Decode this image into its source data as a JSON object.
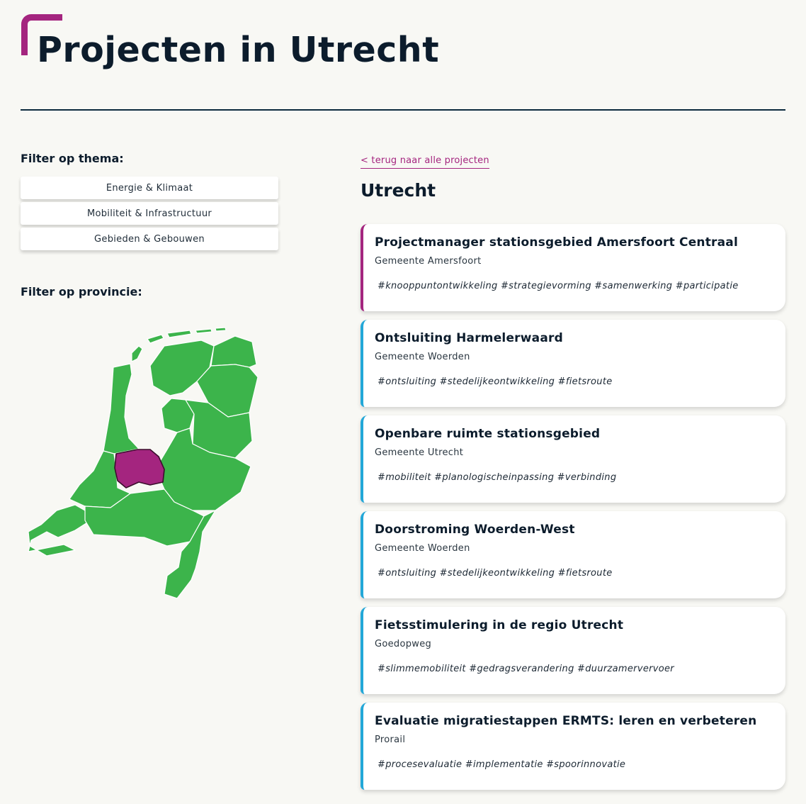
{
  "page": {
    "title": "Projecten in Utrecht"
  },
  "colors": {
    "accent": "#a4257f",
    "map_fill": "#3cb44b",
    "selected_province": "#a4257f",
    "card_border": "#22a7d8"
  },
  "filters": {
    "theme_heading": "Filter op thema:",
    "themes": [
      "Energie & Klimaat",
      "Mobiliteit & Infrastructuur",
      "Gebieden & Gebouwen"
    ],
    "province_heading": "Filter op provincie:",
    "selected_province": "Utrecht"
  },
  "results": {
    "back_link": "< terug naar alle projecten",
    "heading": "Utrecht",
    "projects": [
      {
        "title": "Projectmanager stationsgebied Amersfoort Centraal",
        "org": "Gemeente Amersfoort",
        "tags": "#knooppuntontwikkeling #strategievorming #samenwerking #participatie"
      },
      {
        "title": "Ontsluiting Harmelerwaard",
        "org": "Gemeente Woerden",
        "tags": "#ontsluiting #stedelijkeontwikkeling #fietsroute"
      },
      {
        "title": "Openbare ruimte stationsgebied",
        "org": "Gemeente Utrecht",
        "tags": "#mobiliteit #planologischeinpassing #verbinding"
      },
      {
        "title": "Doorstroming Woerden-West",
        "org": "Gemeente Woerden",
        "tags": "#ontsluiting #stedelijkeontwikkeling #fietsroute"
      },
      {
        "title": "Fietsstimulering in de regio Utrecht",
        "org": "Goedopweg",
        "tags": "#slimmemobiliteit #gedragsverandering #duurzamervervoer"
      },
      {
        "title": "Evaluatie migratiestappen ERMTS: leren en verbeteren",
        "org": "Prorail",
        "tags": "#procesevaluatie #implementatie #spoorinnovatie"
      }
    ]
  }
}
